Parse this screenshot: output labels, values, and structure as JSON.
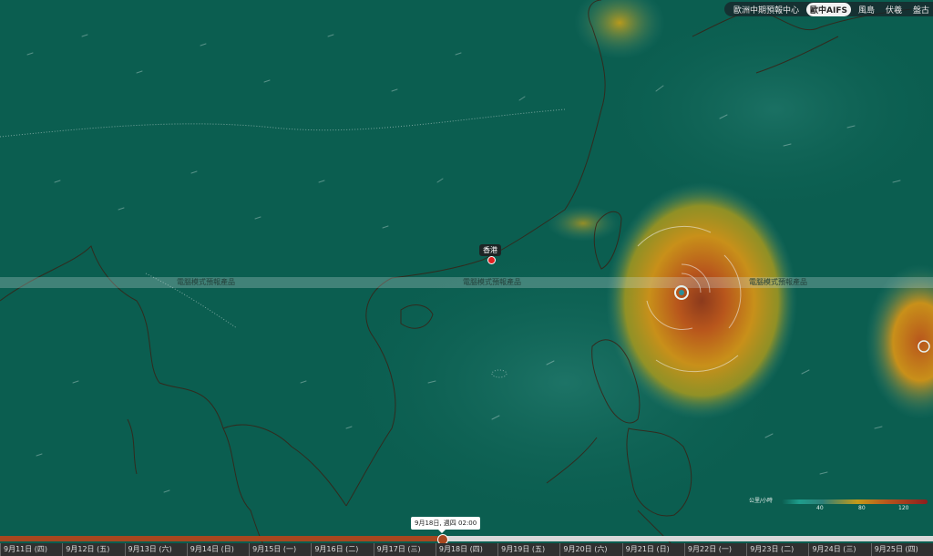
{
  "model_tabs": [
    {
      "label": "歐洲中期預報中心",
      "active": false
    },
    {
      "label": "歐中AIFS",
      "active": true
    },
    {
      "label": "風島",
      "active": false
    },
    {
      "label": "伏羲",
      "active": false
    },
    {
      "label": "盤古",
      "active": false
    }
  ],
  "overlay_label": "電腦模式預報產品",
  "city": {
    "name": "香港"
  },
  "legend": {
    "unit": "公里/小時",
    "ticks": [
      "40",
      "80",
      "120"
    ],
    "colors": [
      "#0b5e50",
      "#1e9d8c",
      "#2d7f77",
      "#c49a1a",
      "#b8561c",
      "#8c1e1e"
    ]
  },
  "timeline": {
    "current_time": "9月18日, 週四 02:00",
    "progress": 0.474,
    "days": [
      "9月11日 (四)",
      "9月12日 (五)",
      "9月13日 (六)",
      "9月14日 (日)",
      "9月15日 (一)",
      "9月16日 (二)",
      "9月17日 (三)",
      "9月18日 (四)",
      "9月19日 (五)",
      "9月20日 (六)",
      "9月21日 (日)",
      "9月22日 (一)",
      "9月23日 (二)",
      "9月24日 (三)",
      "9月25日 (四)"
    ]
  }
}
